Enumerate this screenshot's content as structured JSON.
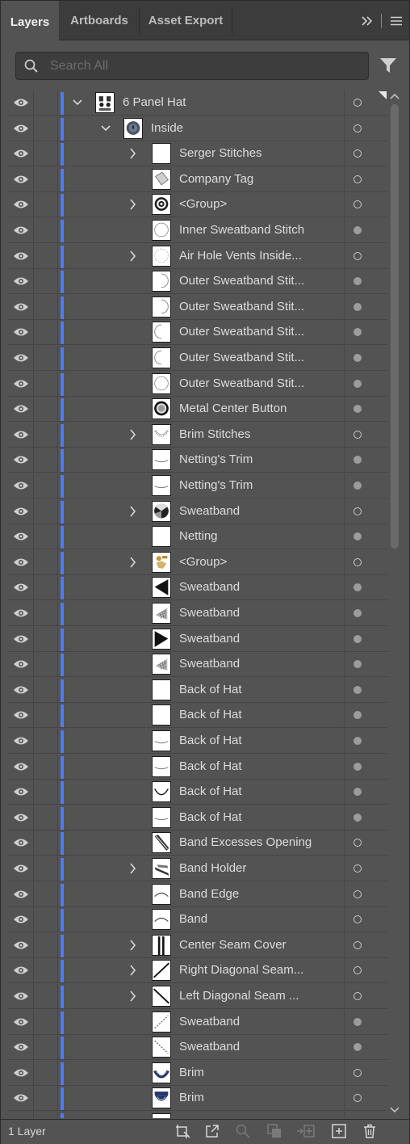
{
  "tabs": [
    {
      "label": "Layers",
      "active": true
    },
    {
      "label": "Artboards",
      "active": false
    },
    {
      "label": "Asset Export",
      "active": false
    }
  ],
  "search": {
    "placeholder": "Search All"
  },
  "rows": [
    {
      "name": "6 Panel Hat",
      "level": 0,
      "expander": "expanded",
      "thumb": "layer",
      "target": "empty"
    },
    {
      "name": "Inside",
      "level": 1,
      "expander": "expanded",
      "thumb": "sublayer",
      "target": "empty"
    },
    {
      "name": "Serger Stitches",
      "level": 2,
      "expander": "collapsed",
      "thumb": "blank",
      "target": "empty"
    },
    {
      "name": "Company Tag",
      "level": 2,
      "expander": "none",
      "thumb": "tag",
      "target": "empty"
    },
    {
      "name": "<Group>",
      "level": 2,
      "expander": "collapsed",
      "thumb": "target-rings",
      "target": "empty"
    },
    {
      "name": "Inner Sweatband Stitch",
      "level": 2,
      "expander": "none",
      "thumb": "circle-outline",
      "target": "filled"
    },
    {
      "name": "Air Hole Vents Inside...",
      "level": 2,
      "expander": "collapsed",
      "thumb": "dotted",
      "target": "empty"
    },
    {
      "name": "Outer Sweatband Stit...",
      "level": 2,
      "expander": "none",
      "thumb": "arc-right",
      "target": "filled"
    },
    {
      "name": "Outer Sweatband Stit...",
      "level": 2,
      "expander": "none",
      "thumb": "arc-right",
      "target": "filled"
    },
    {
      "name": "Outer Sweatband Stit...",
      "level": 2,
      "expander": "none",
      "thumb": "arc-left",
      "target": "filled"
    },
    {
      "name": "Outer Sweatband Stit...",
      "level": 2,
      "expander": "none",
      "thumb": "arc-left",
      "target": "filled"
    },
    {
      "name": "Outer Sweatband Stit...",
      "level": 2,
      "expander": "none",
      "thumb": "circle-outline",
      "target": "filled"
    },
    {
      "name": "Metal Center Button",
      "level": 2,
      "expander": "none",
      "thumb": "button",
      "target": "filled"
    },
    {
      "name": "Brim Stitches",
      "level": 2,
      "expander": "collapsed",
      "thumb": "brim-stitch",
      "target": "empty"
    },
    {
      "name": "Netting's Trim",
      "level": 2,
      "expander": "none",
      "thumb": "curve-line",
      "target": "filled"
    },
    {
      "name": "Netting's Trim",
      "level": 2,
      "expander": "none",
      "thumb": "curve-line",
      "target": "filled"
    },
    {
      "name": "Sweatband",
      "level": 2,
      "expander": "collapsed",
      "thumb": "sweat-circle",
      "target": "empty"
    },
    {
      "name": "Netting",
      "level": 2,
      "expander": "none",
      "thumb": "blank",
      "target": "filled"
    },
    {
      "name": "<Group>",
      "level": 2,
      "expander": "collapsed",
      "thumb": "figure",
      "target": "empty"
    },
    {
      "name": "Sweatband",
      "level": 2,
      "expander": "none",
      "thumb": "wedge-left",
      "target": "filled"
    },
    {
      "name": "Sweatband",
      "level": 2,
      "expander": "none",
      "thumb": "mesh",
      "target": "filled"
    },
    {
      "name": "Sweatband",
      "level": 2,
      "expander": "none",
      "thumb": "wedge-right",
      "target": "filled"
    },
    {
      "name": "Sweatband",
      "level": 2,
      "expander": "none",
      "thumb": "mesh",
      "target": "filled"
    },
    {
      "name": "Back of Hat",
      "level": 2,
      "expander": "none",
      "thumb": "blank",
      "target": "filled"
    },
    {
      "name": "Back of Hat",
      "level": 2,
      "expander": "none",
      "thumb": "blank",
      "target": "filled"
    },
    {
      "name": "Back of Hat",
      "level": 2,
      "expander": "none",
      "thumb": "curve-line",
      "target": "filled"
    },
    {
      "name": "Back of Hat",
      "level": 2,
      "expander": "none",
      "thumb": "curve-line",
      "target": "filled"
    },
    {
      "name": "Back of Hat",
      "level": 2,
      "expander": "none",
      "thumb": "bowl",
      "target": "filled"
    },
    {
      "name": "Back of Hat",
      "level": 2,
      "expander": "none",
      "thumb": "curve-line",
      "target": "filled"
    },
    {
      "name": "Band Excesses Opening",
      "level": 2,
      "expander": "none",
      "thumb": "diag-band",
      "target": "empty"
    },
    {
      "name": "Band Holder",
      "level": 2,
      "expander": "collapsed",
      "thumb": "holder",
      "target": "empty"
    },
    {
      "name": "Band Edge",
      "level": 2,
      "expander": "none",
      "thumb": "arch",
      "target": "empty"
    },
    {
      "name": "Band",
      "level": 2,
      "expander": "none",
      "thumb": "arch",
      "target": "empty"
    },
    {
      "name": "Center Seam Cover",
      "level": 2,
      "expander": "collapsed",
      "thumb": "vertical-seam",
      "target": "empty"
    },
    {
      "name": "Right Diagonal Seam...",
      "level": 2,
      "expander": "collapsed",
      "thumb": "diag-up",
      "target": "empty"
    },
    {
      "name": "Left Diagonal Seam ...",
      "level": 2,
      "expander": "collapsed",
      "thumb": "diag-down",
      "target": "empty"
    },
    {
      "name": "Sweatband",
      "level": 2,
      "expander": "none",
      "thumb": "dash-up",
      "target": "filled"
    },
    {
      "name": "Sweatband",
      "level": 2,
      "expander": "none",
      "thumb": "dash-down",
      "target": "filled"
    },
    {
      "name": "Brim",
      "level": 2,
      "expander": "none",
      "thumb": "brim",
      "target": "empty"
    },
    {
      "name": "Brim",
      "level": 2,
      "expander": "none",
      "thumb": "brim2",
      "target": "empty"
    },
    {
      "name": "",
      "level": 2,
      "expander": "none",
      "thumb": "brim",
      "target": "empty"
    }
  ],
  "footer": {
    "layer_count": "1 Layer"
  },
  "colors": {
    "layer_color": "#4f7bf0",
    "panel_bg": "#535353",
    "tab_bar_bg": "#3c3c3c"
  },
  "icons": {
    "tabbar": [
      "double-chevron-right-icon",
      "panel-menu-icon"
    ],
    "footer": [
      "collect-for-export-icon",
      "export-icon",
      "locate-object-icon",
      "make-clipping-mask-icon",
      "create-sublayer-icon",
      "new-layer-icon",
      "delete-icon"
    ]
  }
}
